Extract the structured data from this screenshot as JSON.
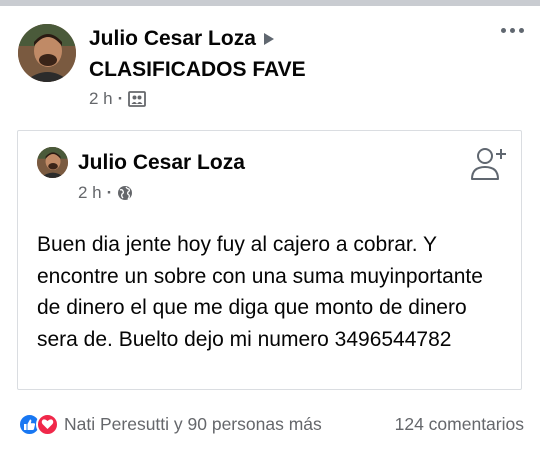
{
  "post": {
    "author": "Julio Cesar Loza",
    "group": "CLASIFICADOS FAVE",
    "time": "2 h",
    "privacy_icon": "group-icon",
    "menu_icon": "more-options-icon"
  },
  "shared": {
    "author": "Julio Cesar Loza",
    "time": "2 h",
    "privacy_icon": "globe-icon",
    "action_icon": "add-friend-icon",
    "text": "Buen dia jente hoy fuy al cajero a cobrar. Y encontre un sobre con una suma muyinportante de  dinero el que me diga que monto de dinero sera de. Buelto dejo mi numero 3496544782"
  },
  "footer": {
    "reactions_label": "Nati Peresutti y 90 personas más",
    "comments_label": "124 comentarios",
    "reaction_icons": [
      "like-icon",
      "love-icon"
    ]
  },
  "colors": {
    "text_primary": "#050505",
    "text_secondary": "#65676b",
    "like_blue": "#1877f2",
    "love_red": "#f0284a",
    "border": "#dadde1"
  }
}
